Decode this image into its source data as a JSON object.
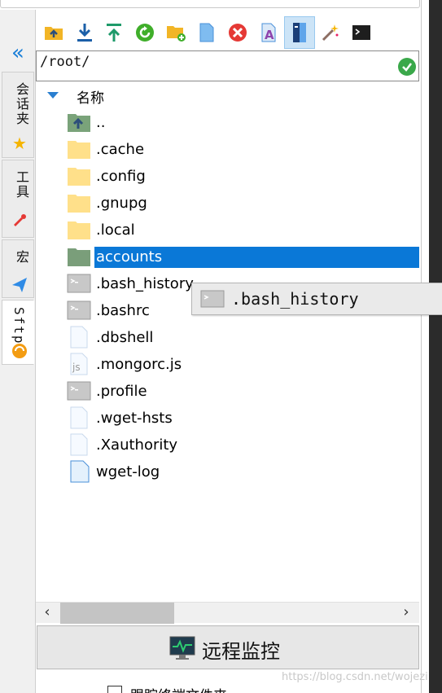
{
  "sidebar": {
    "tabs": [
      {
        "label": "会话夹",
        "icon": "star-icon"
      },
      {
        "label": "工具",
        "icon": "toolbox-icon"
      },
      {
        "label": "宏",
        "icon": "paper-plane-icon"
      },
      {
        "label": "Sftp",
        "icon": "sftp-icon"
      }
    ]
  },
  "toolbar": {
    "buttons": [
      "parent-folder-icon",
      "download-icon",
      "upload-icon",
      "refresh-icon",
      "new-folder-icon",
      "new-file-icon",
      "delete-icon",
      "rename-icon",
      "toggle-hidden-icon",
      "magic-wand-icon",
      "terminal-icon"
    ]
  },
  "path": {
    "value": "/root/"
  },
  "tree": {
    "header": "名称",
    "rows": [
      {
        "name": "..",
        "icon": "parent-folder-icon"
      },
      {
        "name": ".cache",
        "icon": "folder-icon"
      },
      {
        "name": ".config",
        "icon": "folder-icon"
      },
      {
        "name": ".gnupg",
        "icon": "folder-icon"
      },
      {
        "name": ".local",
        "icon": "folder-icon"
      },
      {
        "name": "accounts",
        "icon": "folder-icon",
        "selected": true
      },
      {
        "name": ".bash_history",
        "icon": "terminal-file-icon"
      },
      {
        "name": ".bashrc",
        "icon": "terminal-file-icon"
      },
      {
        "name": ".dbshell",
        "icon": "file-icon"
      },
      {
        "name": ".mongorc.js",
        "icon": "js-file-icon"
      },
      {
        "name": ".profile",
        "icon": "terminal-file-icon"
      },
      {
        "name": ".wget-hsts",
        "icon": "file-icon"
      },
      {
        "name": ".Xauthority",
        "icon": "file-icon"
      },
      {
        "name": "wget-log",
        "icon": "file-icon"
      }
    ]
  },
  "tooltip": {
    "text": ".bash_history"
  },
  "monitor": {
    "label": "远程监控"
  },
  "follow": {
    "label": "跟踪终端文件夹"
  },
  "watermark": {
    "text": "https://blog.csdn.net/wojezi"
  },
  "colors": {
    "selection": "#0a78d7",
    "folder": "#ffe08a",
    "accent": "#1a7fd8"
  }
}
